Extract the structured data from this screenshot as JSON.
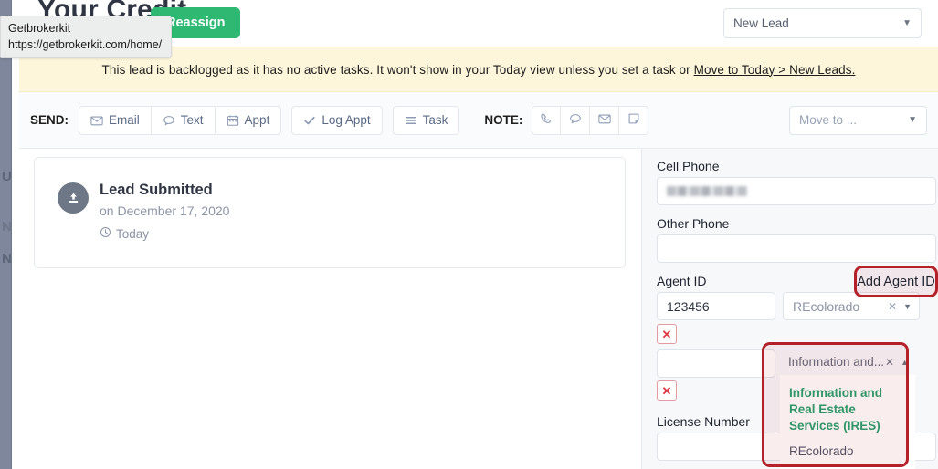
{
  "browser_tooltip": {
    "name": "Getbrokerkit",
    "url": "https://getbrokerkit.com/home/"
  },
  "header": {
    "page_title": "Your Credit",
    "reassign_label": "Reassign",
    "status_value": "New Lead",
    "caret_icon": "chevron-down-icon"
  },
  "banner": {
    "text": "This lead is backlogged as it has no active tasks. It won't show in your Today view unless you set a task or ",
    "link": "Move to Today > New Leads."
  },
  "toolbar": {
    "send_label": "SEND:",
    "send_buttons": [
      {
        "label": "Email",
        "icon": "envelope-icon"
      },
      {
        "label": "Text",
        "icon": "chat-bubble-icon"
      },
      {
        "label": "Appt",
        "icon": "calendar-icon"
      }
    ],
    "log_appt": {
      "label": "Log Appt",
      "icon": "check-icon"
    },
    "task": {
      "label": "Task",
      "icon": "list-icon"
    },
    "note_label": "NOTE:",
    "note_icons": [
      "phone-icon",
      "chat-bubble-icon",
      "envelope-icon",
      "note-icon"
    ],
    "move_to_value": "Move to ...",
    "caret_icon": "chevron-down-icon"
  },
  "timeline": {
    "icon": "upload-icon",
    "title": "Lead Submitted",
    "subtitle": "on December 17, 2020",
    "today_label": "Today",
    "clock_icon": "clock-icon"
  },
  "details": {
    "cell_phone_label": "Cell Phone",
    "cell_phone_value": "",
    "other_phone_label": "Other Phone",
    "other_phone_value": "",
    "agent_id_label": "Agent ID",
    "add_agent_id_label": "Add Agent ID",
    "agent_id_value": "123456",
    "agent_mls_value": "REcolorado",
    "agent_id_value_2": "",
    "license_number_label": "License Number",
    "license_number_value": "",
    "delete_icon": "x-icon",
    "clear_icon": "x-icon",
    "caret_icon": "chevron-down-icon"
  },
  "dropdown": {
    "selected_display": "Information and...",
    "clear_icon": "x-icon",
    "collapse_icon": "chevron-up-icon",
    "options": [
      {
        "label": "Information and Real Estate Services (IRES)",
        "selected": true
      },
      {
        "label": "REcolorado",
        "selected": false
      }
    ]
  },
  "sidebar": {
    "items": [
      "U",
      "N",
      "N"
    ]
  },
  "colors": {
    "accent_green": "#2eb872",
    "banner_yellow": "#fdf6db",
    "annotation_red": "#b52128",
    "option_green": "#22a06b",
    "sidebar_slate": "#7e879b"
  }
}
